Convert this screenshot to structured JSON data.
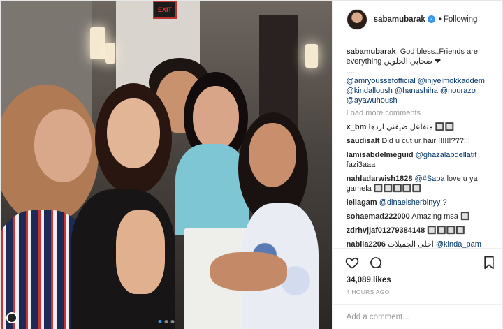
{
  "post": {
    "username": "sabamubarak",
    "verified_mark": "✓",
    "separator": "•",
    "follow_status": "Following"
  },
  "photo": {
    "exit_sign": "EXIT",
    "carousel_dots": 3,
    "active_dot": 0
  },
  "caption": {
    "username": "sabamubarak",
    "text": "God bless..Friends are everything صحابي الحلوين ❤",
    "dots": "......",
    "mentions": "@amryoussefofficial @injyelmokkaddem @kindalloush @hanashiha @nourazo @ayawuhoush"
  },
  "load_more": "Load more comments",
  "comments": [
    {
      "user": "x_bm",
      "text": "متفاعل ضيفني اردها 🔲🔲"
    },
    {
      "user": "saudisalt",
      "text": "Did u cut ur hair !!!!!!???!!!"
    },
    {
      "user": "lamisabdelmeguid",
      "mention": "@ghazalabdellatif",
      "text": "fazi3aaa"
    },
    {
      "user": "nahladarwish1828",
      "mention": "@#Saba",
      "text": "love u ya gamela 🔲🔲🔲🔲🔲"
    },
    {
      "user": "leilagam",
      "mention": "@dinaelsherbinyy",
      "text": "?"
    },
    {
      "user": "sohaemad222000",
      "text": "Amazing msa 🔲"
    },
    {
      "user": "zdrhvjjaf01279384148",
      "text": "🔲🔲🔲🔲"
    },
    {
      "user": "nabila2206",
      "text": "احلى الجميلات",
      "mention": "@kinda_pam"
    }
  ],
  "likes": "34,089 likes",
  "time_ago": "4 HOURS AGO",
  "add_comment_placeholder": "Add a comment...",
  "colors": {
    "link": "#003569",
    "accent": "#3897f0",
    "muted": "#999999"
  },
  "icons": [
    "heart-icon",
    "comment-icon",
    "bookmark-icon",
    "verified-icon"
  ]
}
